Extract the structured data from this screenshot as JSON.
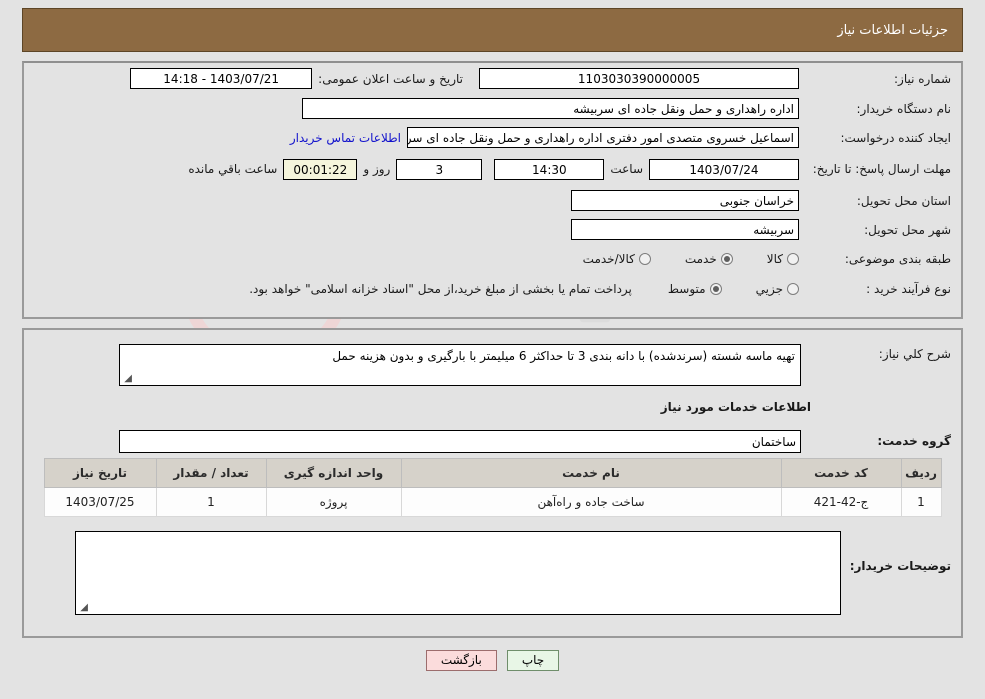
{
  "header": {
    "title": "جزئیات اطلاعات نیاز"
  },
  "form": {
    "need_number": {
      "label": "شماره نیاز:",
      "value": "1103030390000005"
    },
    "announce_datetime": {
      "label": "تاریخ و ساعت اعلان عمومی:",
      "value": "1403/07/21 - 14:18"
    },
    "buyer_org": {
      "label": "نام دستگاه خریدار:",
      "value": "اداره راهداری و حمل ونقل جاده ای سربیشه"
    },
    "requester": {
      "label": "ایجاد کننده درخواست:",
      "value": "اسماعیل خسروی متصدی امور دفتری  اداره راهداری و حمل ونقل جاده ای سربیشه",
      "contact_link": "اطلاعات تماس خریدار"
    },
    "deadline": {
      "label": "مهلت ارسال پاسخ: تا تاریخ:",
      "date": "1403/07/24",
      "time_label": "ساعت",
      "time": "14:30",
      "days": "3",
      "days_suffix": "روز و",
      "countdown": "00:01:22",
      "countdown_suffix": "ساعت باقي مانده"
    },
    "delivery_province": {
      "label": "استان محل تحویل:",
      "value": "خراسان جنوبی"
    },
    "delivery_city": {
      "label": "شهر محل تحویل:",
      "value": "سربیشه"
    },
    "category": {
      "label": "طبقه بندی موضوعی:",
      "options": [
        {
          "label": "کالا",
          "selected": false
        },
        {
          "label": "خدمت",
          "selected": true
        },
        {
          "label": "کالا/خدمت",
          "selected": false
        }
      ]
    },
    "process_type": {
      "label": "نوع فرآیند خرید :",
      "options": [
        {
          "label": "جزيي",
          "selected": false
        },
        {
          "label": "متوسط",
          "selected": true
        }
      ],
      "note": "پرداخت تمام یا بخشی از مبلغ خرید،از محل \"اسناد خزانه اسلامی\" خواهد بود."
    }
  },
  "description": {
    "label": "شرح کلي نیاز:",
    "value": "تهیه ماسه شسته (سرندشده) با دانه بندی 3 تا حداکثر 6 میلیمتر با بارگیری و بدون هزینه حمل"
  },
  "services": {
    "heading": "اطلاعات خدمات مورد نیاز",
    "group_label": "گروه خدمت:",
    "group_value": "ساختمان",
    "table": {
      "columns": [
        "ردیف",
        "کد خدمت",
        "نام خدمت",
        "واحد اندازه گیری",
        "تعداد / مقدار",
        "تاریخ نیاز"
      ],
      "rows": [
        [
          "1",
          "ج-42-421",
          "ساخت جاده و راه‌آهن",
          "پروژه",
          "1",
          "1403/07/25"
        ]
      ]
    }
  },
  "buyer_notes": {
    "label": "توضیحات خریدار:",
    "value": ""
  },
  "buttons": {
    "print": "چاپ",
    "back": "بازگشت"
  },
  "colors": {
    "header_bg": "#8d6a42",
    "page_bg": "#e3e3e3",
    "link": "#1111cc",
    "table_header_bg": "#d6d2ca",
    "print_btn_bg": "#e8f6e6",
    "back_btn_bg": "#fbdcdc"
  }
}
